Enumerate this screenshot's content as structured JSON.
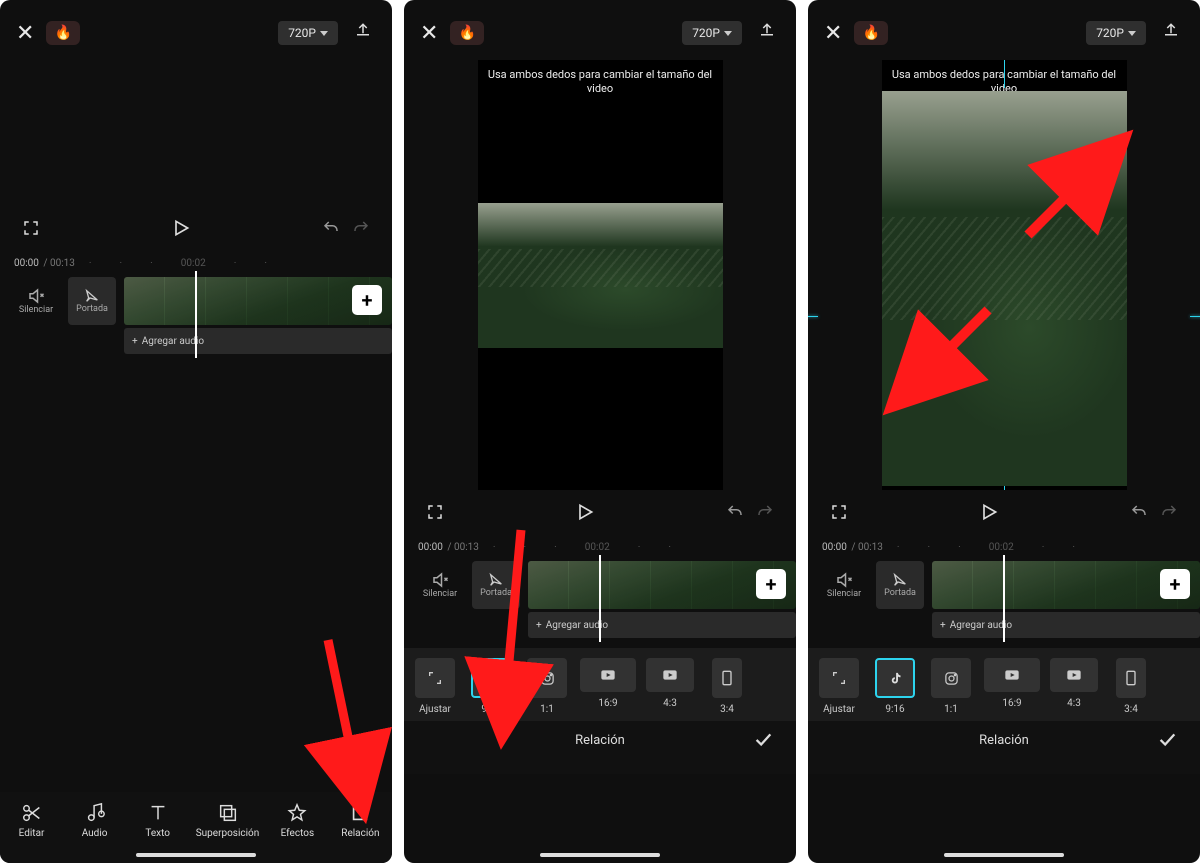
{
  "topbar": {
    "resolution_label": "720P"
  },
  "hint": "Usa ambos dedos para cambiar el tamaño del video",
  "time": {
    "current": "00:00",
    "total": "00:13",
    "mark1": "00:02",
    "mark2": "00:0"
  },
  "tracks": {
    "mute_label": "Silenciar",
    "cover_label": "Portada",
    "add_audio_label": "Agregar audio"
  },
  "tools": {
    "edit": "Editar",
    "audio": "Audio",
    "text": "Texto",
    "overlay": "Superposición",
    "effects": "Efectos",
    "ratio": "Relación"
  },
  "ratio": {
    "title": "Relación",
    "adjust": "Ajustar",
    "r916": "9:16",
    "r11": "1:1",
    "r169": "16:9",
    "r43": "4:3",
    "r34": "3:4"
  }
}
